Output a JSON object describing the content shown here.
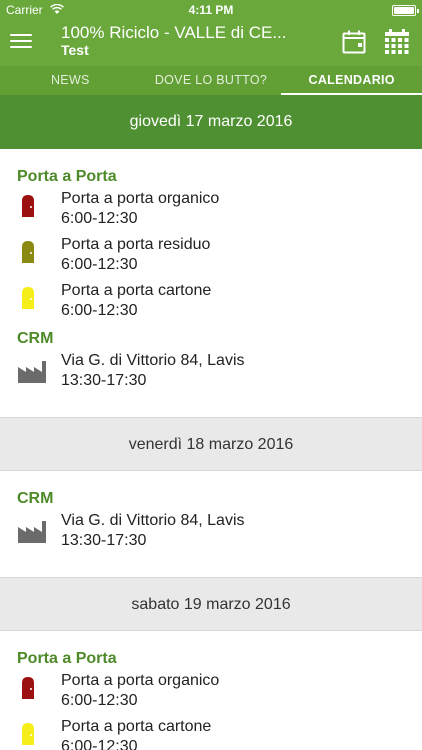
{
  "status_bar": {
    "carrier": "Carrier",
    "time": "4:11 PM",
    "battery_level": 1.0
  },
  "nav": {
    "title": "100% Riciclo - VALLE di CE...",
    "subtitle": "Test",
    "icons": [
      "menu-icon",
      "calendar-icon",
      "calendar-grid-icon"
    ]
  },
  "tabs": [
    {
      "label": "NEWS",
      "active": false
    },
    {
      "label": "DOVE LO BUTTO?",
      "active": false
    },
    {
      "label": "CALENDARIO",
      "active": true
    }
  ],
  "colors": {
    "brand": "#6aa83c",
    "day_header_active": "#4f9132",
    "section_title": "#4f8a2a",
    "organico": "#9b1010",
    "residuo": "#8a8a12",
    "cartone": "#f5ee1a",
    "crm": "#6b6b6b"
  },
  "days": [
    {
      "date": "giovedì 17 marzo 2016",
      "sections": [
        {
          "title": "Porta a Porta",
          "entries": [
            {
              "name": "Porta a porta organico",
              "hours": "6:00-12:30",
              "icon": "door-icon-organico"
            },
            {
              "name": "Porta a porta residuo",
              "hours": "6:00-12:30",
              "icon": "door-icon-residuo"
            },
            {
              "name": "Porta a porta cartone",
              "hours": "6:00-12:30",
              "icon": "door-icon-cartone"
            }
          ]
        },
        {
          "title": "CRM",
          "entries": [
            {
              "name": "Via G. di Vittorio 84, Lavis",
              "hours": "13:30-17:30",
              "icon": "factory-icon"
            }
          ]
        }
      ]
    },
    {
      "date": "venerdì 18 marzo 2016",
      "sections": [
        {
          "title": "CRM",
          "entries": [
            {
              "name": "Via G. di Vittorio 84, Lavis",
              "hours": "13:30-17:30",
              "icon": "factory-icon"
            }
          ]
        }
      ]
    },
    {
      "date": "sabato 19 marzo 2016",
      "sections": [
        {
          "title": "Porta a Porta",
          "entries": [
            {
              "name": "Porta a porta organico",
              "hours": "6:00-12:30",
              "icon": "door-icon-organico"
            },
            {
              "name": "Porta a porta cartone",
              "hours": "6:00-12:30",
              "icon": "door-icon-cartone"
            }
          ]
        }
      ]
    }
  ]
}
